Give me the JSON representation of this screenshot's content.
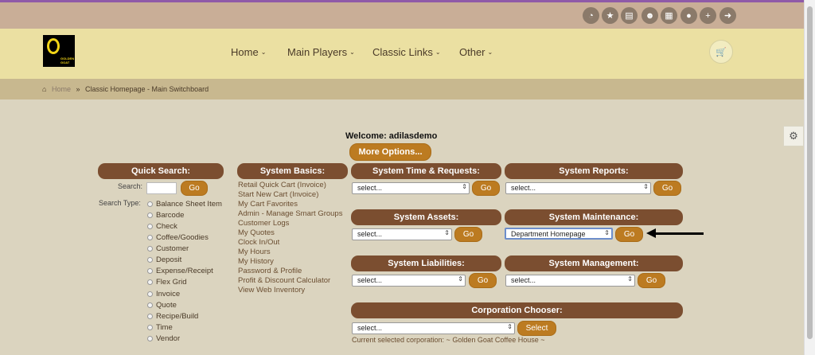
{
  "top_icons": [
    "dashboard-icon",
    "star-icon",
    "document-icon",
    "users-icon",
    "calendar-icon",
    "user-icon",
    "user-plus-icon",
    "signout-icon"
  ],
  "logo": {
    "text_line1": "GOLDEN",
    "text_line2": "GOAT"
  },
  "nav": [
    {
      "label": "Home"
    },
    {
      "label": "Main Players"
    },
    {
      "label": "Classic Links"
    },
    {
      "label": "Other"
    }
  ],
  "breadcrumb": {
    "home": "Home",
    "separator": "»",
    "current": "Classic Homepage - Main Switchboard"
  },
  "welcome": "Welcome: adilasdemo",
  "more_options": "More Options...",
  "quick_search": {
    "title": "Quick Search:",
    "search_label": "Search:",
    "go": "Go",
    "search_type_label": "Search Type:",
    "types": [
      "Balance Sheet Item",
      "Barcode",
      "Check",
      "Coffee/Goodies",
      "Customer",
      "Deposit",
      "Expense/Receipt",
      "Flex Grid",
      "Invoice",
      "Quote",
      "Recipe/Build",
      "Time",
      "Vendor"
    ]
  },
  "system_basics": {
    "title": "System Basics:",
    "links": [
      "Retail Quick Cart (Invoice)",
      "Start New Cart (Invoice)",
      "My Cart Favorites",
      "Admin - Manage Smart Groups",
      "Customer Logs",
      "My Quotes",
      "Clock In/Out",
      "My Hours",
      "My History",
      "Password & Profile",
      "Profit & Discount Calculator",
      "View Web Inventory"
    ]
  },
  "panels": {
    "time_requests": {
      "title": "System Time & Requests:",
      "select": "select...",
      "go": "Go"
    },
    "reports": {
      "title": "System Reports:",
      "select": "select...",
      "go": "Go"
    },
    "assets": {
      "title": "System Assets:",
      "select": "select...",
      "go": "Go"
    },
    "maintenance": {
      "title": "System Maintenance:",
      "select": "Department Homepage",
      "go": "Go"
    },
    "liabilities": {
      "title": "System Liabilities:",
      "select": "select...",
      "go": "Go"
    },
    "management": {
      "title": "System Management:",
      "select": "select...",
      "go": "Go"
    },
    "corporation": {
      "title": "Corporation Chooser:",
      "select": "select...",
      "button": "Select",
      "current": "Current selected corporation: ~ Golden Goat Coffee House ~"
    }
  },
  "colors": {
    "accent": "#bc7b21",
    "panel_header": "#7b4e30",
    "header_bg": "#ebe0a2",
    "topbar_bg": "#c9ae97",
    "body_bg": "#dbd4bf"
  }
}
